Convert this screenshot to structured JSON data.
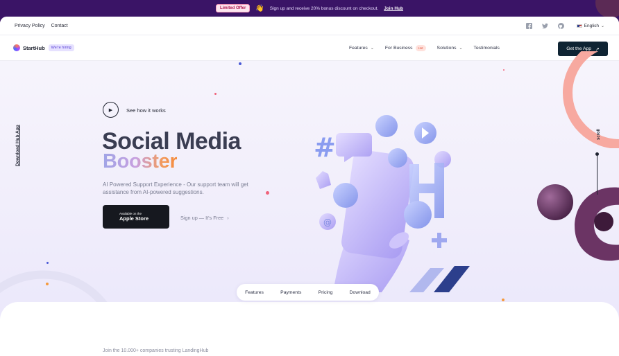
{
  "announcement": {
    "badge": "Limited Offer",
    "message": "Sign up and receive 20% bonus discount on checkout.",
    "link": "Join Hub"
  },
  "topbar": {
    "links": [
      "Privacy Policy",
      "Contact"
    ],
    "language": "English",
    "social_icons": [
      "facebook-icon",
      "twitter-icon",
      "github-icon"
    ]
  },
  "nav": {
    "brand": "StartHub",
    "hiring_badge": "We're hiring",
    "menu": [
      {
        "label": "Features",
        "has_dropdown": true
      },
      {
        "label": "For Business",
        "badge": "Hot"
      },
      {
        "label": "Solutions",
        "has_dropdown": true
      },
      {
        "label": "Testimonials"
      }
    ],
    "cta": "Get the App"
  },
  "side": {
    "download_link": "Download Hub App",
    "scroll_label": "scroll"
  },
  "hero": {
    "video_label": "See how it works",
    "title_line1": "Social Media",
    "title_line2": "Booster",
    "description": "AI Powered Support Experience - Our support team will get assistance from AI-powered suggestions.",
    "store_button": {
      "small": "Available on the",
      "big": "Apple Store"
    },
    "signup_link": "Sign up — It's Free"
  },
  "section_nav": [
    "Features",
    "Payments",
    "Pricing",
    "Download"
  ],
  "trust_text": "Join the 10.000+ companies trusting LandingHub",
  "colors": {
    "topbar": "#3a1466",
    "cta": "#0f2433",
    "accent_gradient_start": "#9fa4e6",
    "accent_gradient_end": "#f58b3b"
  }
}
